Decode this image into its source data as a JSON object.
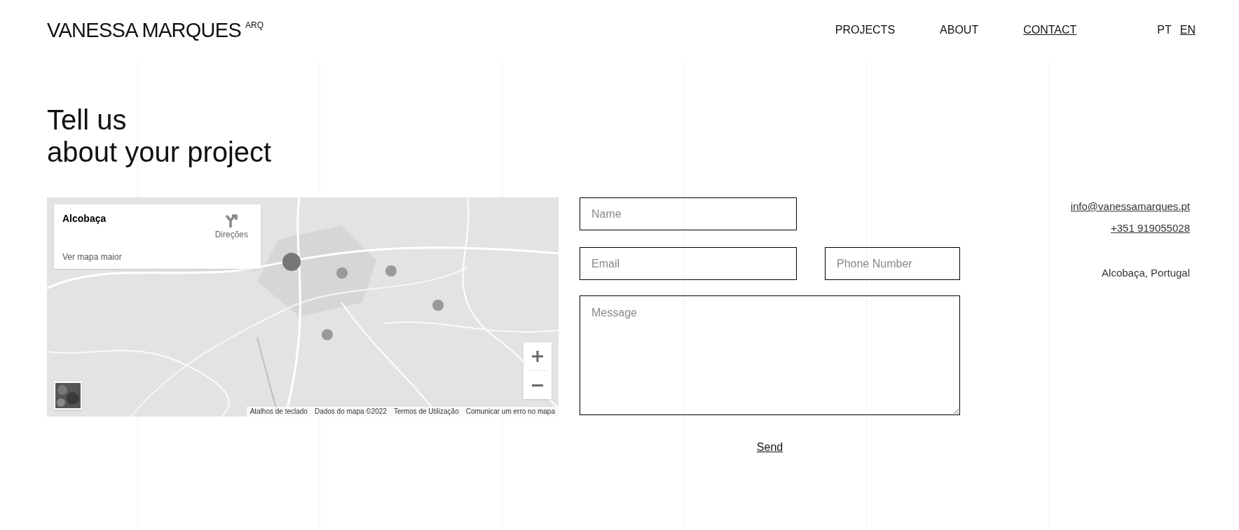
{
  "header": {
    "brand": "VANESSA MARQUES",
    "brand_suffix": "ARQ",
    "nav": [
      {
        "label": "PROJECTS",
        "selected": false
      },
      {
        "label": "ABOUT",
        "selected": false
      },
      {
        "label": "CONTACT",
        "selected": true
      }
    ],
    "languages": [
      {
        "label": "PT",
        "selected": false
      },
      {
        "label": "EN",
        "selected": true
      }
    ]
  },
  "heading": [
    "Tell us",
    "about your project"
  ],
  "map": {
    "place_card": {
      "title": "Alcobaça",
      "directions": "Direções",
      "larger_map": "Ver mapa maior"
    },
    "attribution": [
      "Atalhos de teclado",
      "Dados do mapa ©2022",
      "Termos de Utilização",
      "Comunicar um erro no mapa"
    ]
  },
  "form": {
    "fields": [
      {
        "kind": "input",
        "placeholder": "Name"
      },
      {
        "kind": "input",
        "placeholder": "Email"
      },
      {
        "kind": "input",
        "placeholder": "Phone Number"
      },
      {
        "kind": "textarea",
        "placeholder": "Message"
      }
    ],
    "submit": "Send"
  },
  "contact": {
    "email": "info@vanessamarques.pt",
    "phone": "+351 919055028",
    "location": "Alcobaça, Portugal"
  }
}
